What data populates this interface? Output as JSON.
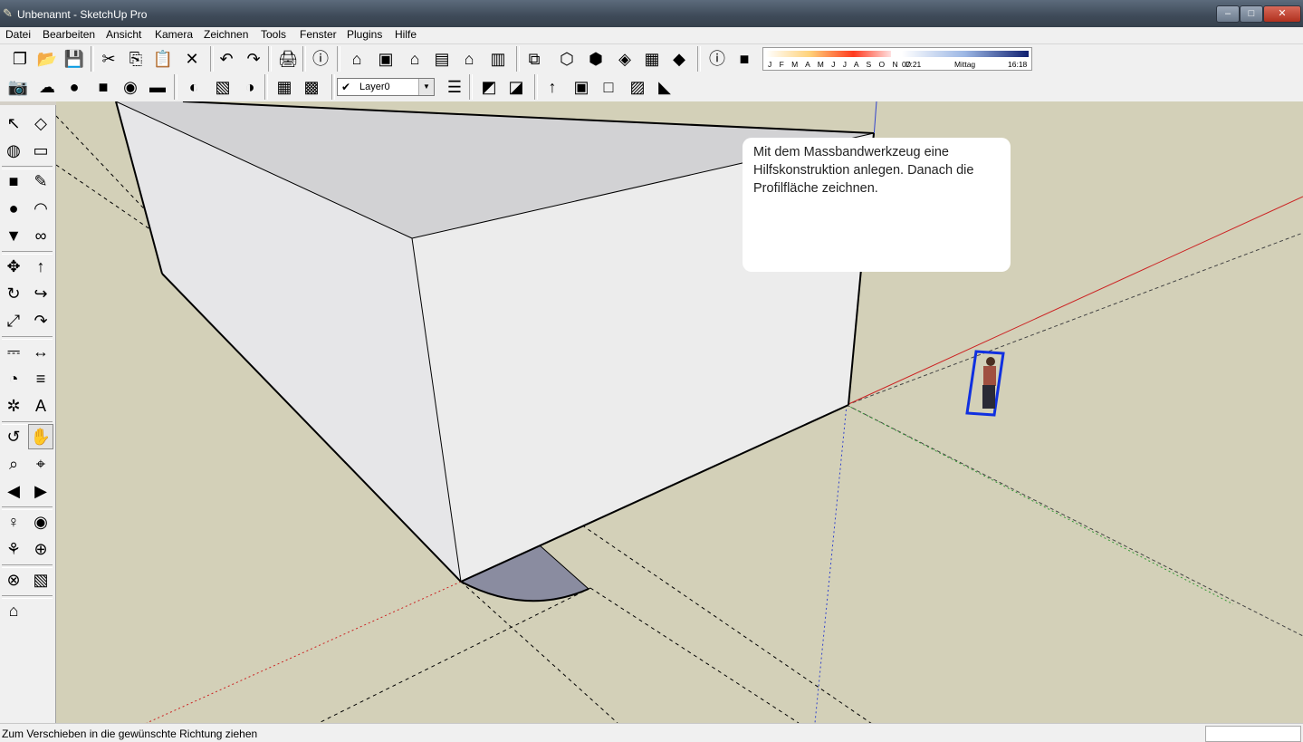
{
  "window": {
    "title": "Unbenannt - SketchUp Pro",
    "min": "–",
    "restore": "□",
    "close": "✕"
  },
  "menu": [
    "Datei",
    "Bearbeiten",
    "Ansicht",
    "Kamera",
    "Zeichnen",
    "Tools",
    "Fenster",
    "Plugins",
    "Hilfe"
  ],
  "layer": {
    "check": "✔",
    "name": "Layer0",
    "arrow": "▼"
  },
  "shadows": {
    "months": "J F M A M J J A S O N D",
    "time_start": "07:21",
    "time_mid": "Mittag",
    "time_end": "16:18"
  },
  "instructor": {
    "text": " Mit dem Massbandwerkzeug eine Hilfskonstruktion anlegen. Danach die Profilfläche zeichnen."
  },
  "status": {
    "message": "Zum Verschieben in die gewünschte Richtung ziehen"
  },
  "toolbar_row1": [
    {
      "name": "new-file-icon",
      "glyph": "❐"
    },
    {
      "name": "open-folder-icon",
      "glyph": "📂"
    },
    {
      "name": "save-icon",
      "glyph": "💾"
    },
    {
      "name": "cut-icon",
      "glyph": "✂"
    },
    {
      "name": "copy-icon",
      "glyph": "⎘"
    },
    {
      "name": "paste-icon",
      "glyph": "📋"
    },
    {
      "name": "erase-icon",
      "glyph": "✕"
    },
    {
      "name": "undo-icon",
      "glyph": "↶"
    },
    {
      "name": "redo-icon",
      "glyph": "↷"
    },
    {
      "name": "print-icon",
      "glyph": "🖨"
    },
    {
      "name": "model-info-icon",
      "glyph": "ⓘ"
    },
    {
      "name": "view-iso-icon",
      "glyph": "⌂"
    },
    {
      "name": "view-top-icon",
      "glyph": "▣"
    },
    {
      "name": "view-front-icon",
      "glyph": "⌂"
    },
    {
      "name": "view-right-icon",
      "glyph": "▤"
    },
    {
      "name": "view-back-icon",
      "glyph": "⌂"
    },
    {
      "name": "view-left-icon",
      "glyph": "▥"
    },
    {
      "name": "xray-icon",
      "glyph": "⧉"
    },
    {
      "name": "wireframe-icon",
      "glyph": "⬡"
    },
    {
      "name": "hidden-line-icon",
      "glyph": "⬢"
    },
    {
      "name": "shaded-icon",
      "glyph": "◈"
    },
    {
      "name": "shaded-texture-icon",
      "glyph": "▦"
    },
    {
      "name": "monochrome-icon",
      "glyph": "◆"
    },
    {
      "name": "shadow-info-icon",
      "glyph": "ⓘ"
    },
    {
      "name": "shadow-toggle-icon",
      "glyph": "■"
    }
  ],
  "toolbar_row2": [
    {
      "name": "camera-position-icon",
      "glyph": "📷"
    },
    {
      "name": "sky-icon",
      "glyph": "☁"
    },
    {
      "name": "sphere-icon",
      "glyph": "●"
    },
    {
      "name": "cube-icon",
      "glyph": "■"
    },
    {
      "name": "globe-icon",
      "glyph": "◉"
    },
    {
      "name": "book-icon",
      "glyph": "▬"
    },
    {
      "name": "get-location-icon",
      "glyph": "◐"
    },
    {
      "name": "toggle-terrain-icon",
      "glyph": "▧"
    },
    {
      "name": "google-earth-icon",
      "glyph": "◑"
    },
    {
      "name": "components-icon",
      "glyph": "▦"
    },
    {
      "name": "share-component-icon",
      "glyph": "▩"
    },
    {
      "name": "layer-manager-icon",
      "glyph": "☰"
    },
    {
      "name": "sandbox-contours-icon",
      "glyph": "◩"
    },
    {
      "name": "sandbox-scratch-icon",
      "glyph": "◪"
    },
    {
      "name": "smoove-icon",
      "glyph": "↑"
    },
    {
      "name": "stamp-icon",
      "glyph": "▣"
    },
    {
      "name": "drape-icon",
      "glyph": "□"
    },
    {
      "name": "add-detail-icon",
      "glyph": "▨"
    },
    {
      "name": "flip-edge-icon",
      "glyph": "◣"
    }
  ],
  "tools": [
    {
      "name": "select-tool-icon",
      "glyph": "↖"
    },
    {
      "name": "make-component-icon",
      "glyph": "◇"
    },
    {
      "name": "paint-bucket-icon",
      "glyph": "◍"
    },
    {
      "name": "eraser-tool-icon",
      "glyph": "▭"
    },
    {
      "name": "rectangle-tool-icon",
      "glyph": "■"
    },
    {
      "name": "pencil-tool-icon",
      "glyph": "✎"
    },
    {
      "name": "circle-tool-icon",
      "glyph": "●"
    },
    {
      "name": "arc-tool-icon",
      "glyph": "◠"
    },
    {
      "name": "polygon-tool-icon",
      "glyph": "▼"
    },
    {
      "name": "freehand-tool-icon",
      "glyph": "∞"
    },
    {
      "name": "move-tool-icon",
      "glyph": "✥"
    },
    {
      "name": "push-pull-tool-icon",
      "glyph": "↑"
    },
    {
      "name": "rotate-tool-icon",
      "glyph": "↻"
    },
    {
      "name": "follow-me-tool-icon",
      "glyph": "↪"
    },
    {
      "name": "scale-tool-icon",
      "glyph": "⤢"
    },
    {
      "name": "offset-tool-icon",
      "glyph": "↷"
    },
    {
      "name": "tape-measure-tool-icon",
      "glyph": "⎓"
    },
    {
      "name": "dimension-tool-icon",
      "glyph": "↔"
    },
    {
      "name": "protractor-tool-icon",
      "glyph": "◔"
    },
    {
      "name": "text-tool-icon",
      "glyph": "≡"
    },
    {
      "name": "axes-tool-icon",
      "glyph": "✲"
    },
    {
      "name": "3d-text-tool-icon",
      "glyph": "A"
    },
    {
      "name": "orbit-tool-icon",
      "glyph": "↺"
    },
    {
      "name": "pan-tool-icon",
      "glyph": "✋"
    },
    {
      "name": "zoom-tool-icon",
      "glyph": "⌕"
    },
    {
      "name": "zoom-window-tool-icon",
      "glyph": "⌖"
    },
    {
      "name": "previous-view-icon",
      "glyph": "◀"
    },
    {
      "name": "zoom-extents-icon",
      "glyph": "▶"
    },
    {
      "name": "position-camera-icon",
      "glyph": "♀"
    },
    {
      "name": "look-around-icon",
      "glyph": "◉"
    },
    {
      "name": "walk-tool-icon",
      "glyph": "⚘"
    },
    {
      "name": "section-plane-icon",
      "glyph": "⊕"
    },
    {
      "name": "section-display-icon",
      "glyph": "⊗"
    },
    {
      "name": "section-cuts-icon",
      "glyph": "▧"
    },
    {
      "name": "section-fill-icon",
      "glyph": "⌂"
    }
  ],
  "colors": {
    "viewport": "#d3d0b8",
    "face_front": "#ebebeb",
    "face_top": "#d2d2d4",
    "face_side": "#e6e6e8",
    "profile": "#8a8ca0"
  }
}
